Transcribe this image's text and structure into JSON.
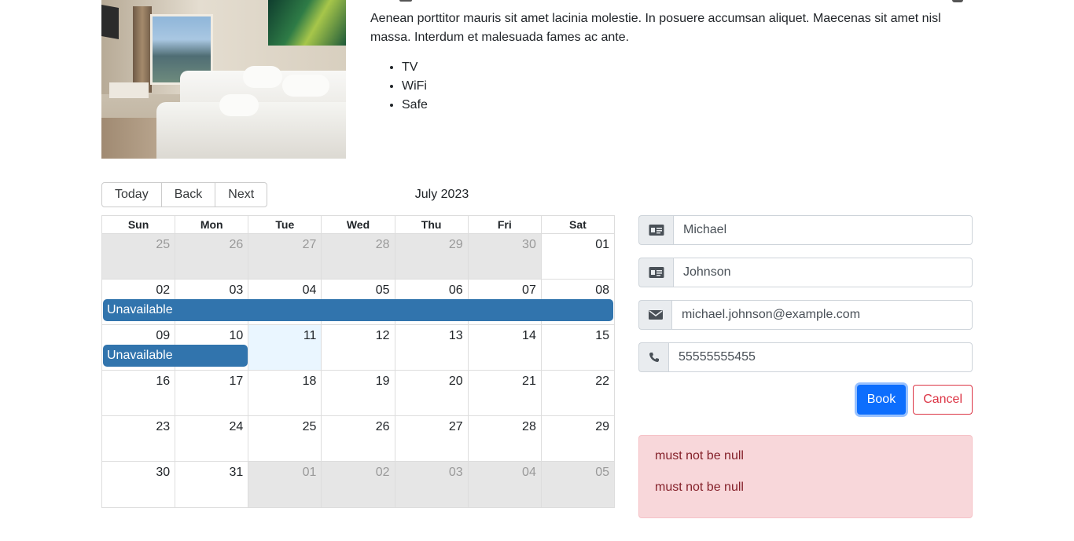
{
  "room": {
    "description": "Aenean porttitor mauris sit amet lacinia molestie. In posuere accumsan aliquet. Maecenas sit amet nisl massa. Interdum et malesuada fames ac ante.",
    "amenities": [
      "TV",
      "WiFi",
      "Safe"
    ]
  },
  "toolbar": {
    "today_label": "Today",
    "back_label": "Back",
    "next_label": "Next",
    "month_label": "July 2023"
  },
  "calendar": {
    "weekdays": [
      "Sun",
      "Mon",
      "Tue",
      "Wed",
      "Thu",
      "Fri",
      "Sat"
    ],
    "weeks": [
      [
        "25",
        "26",
        "27",
        "28",
        "29",
        "30",
        "01"
      ],
      [
        "02",
        "03",
        "04",
        "05",
        "06",
        "07",
        "08"
      ],
      [
        "09",
        "10",
        "11",
        "12",
        "13",
        "14",
        "15"
      ],
      [
        "16",
        "17",
        "18",
        "19",
        "20",
        "21",
        "22"
      ],
      [
        "23",
        "24",
        "25",
        "26",
        "27",
        "28",
        "29"
      ],
      [
        "30",
        "31",
        "01",
        "02",
        "03",
        "04",
        "05"
      ]
    ],
    "events": [
      {
        "title": "Unavailable"
      },
      {
        "title": "Unavailable"
      }
    ]
  },
  "form": {
    "firstname": "Michael",
    "lastname": "Johnson",
    "email": "michael.johnson@example.com",
    "phone": "55555555455",
    "book_label": "Book",
    "cancel_label": "Cancel"
  },
  "errors": [
    "must not be null",
    "must not be null"
  ],
  "colors": {
    "event": "#3174ad",
    "today_bg": "#eaf6ff",
    "off_range_bg": "#e6e6e6",
    "primary": "#0d6efd",
    "danger": "#dc3545",
    "alert_bg": "#f8d7da"
  }
}
